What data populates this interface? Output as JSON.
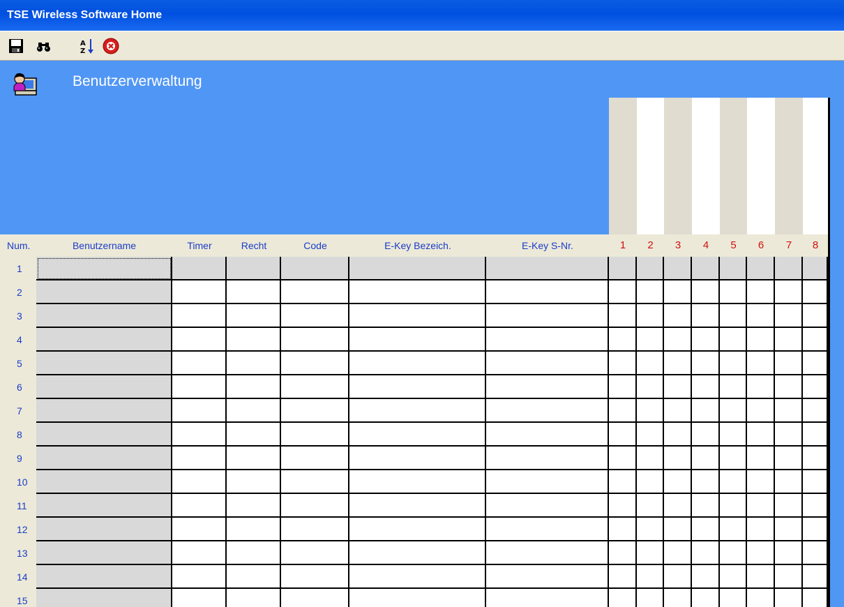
{
  "window": {
    "title": "TSE Wireless Software Home"
  },
  "toolbar": {
    "buttons": [
      {
        "name": "save-button",
        "icon": "floppy-disk-icon"
      },
      {
        "name": "find-button",
        "icon": "binoculars-icon"
      },
      {
        "name": "sort-button",
        "icon": "sort-az-icon"
      },
      {
        "name": "close-button",
        "icon": "red-x-circle-icon"
      }
    ]
  },
  "header": {
    "icon": "user-computer-icon",
    "title": "Benutzerverwaltung"
  },
  "table": {
    "columns": {
      "num": "Num.",
      "name": "Benutzername",
      "timer": "Timer",
      "recht": "Recht",
      "code": "Code",
      "ekey_bez": "E-Key Bezeich.",
      "ekey_snr": "E-Key S-Nr."
    },
    "channels": [
      "1",
      "2",
      "3",
      "4",
      "5",
      "6",
      "7",
      "8"
    ],
    "rows": [
      "1",
      "2",
      "3",
      "4",
      "5",
      "6",
      "7",
      "8",
      "9",
      "10",
      "11",
      "12",
      "13",
      "14",
      "15"
    ]
  },
  "colors": {
    "background": "#5096F5",
    "toolbar": "#ECE9D8",
    "header_text": "#1A3CC8",
    "channel_text": "#D01010",
    "stripe_a": "#E0DCCF",
    "stripe_b": "#FFFFFF"
  }
}
